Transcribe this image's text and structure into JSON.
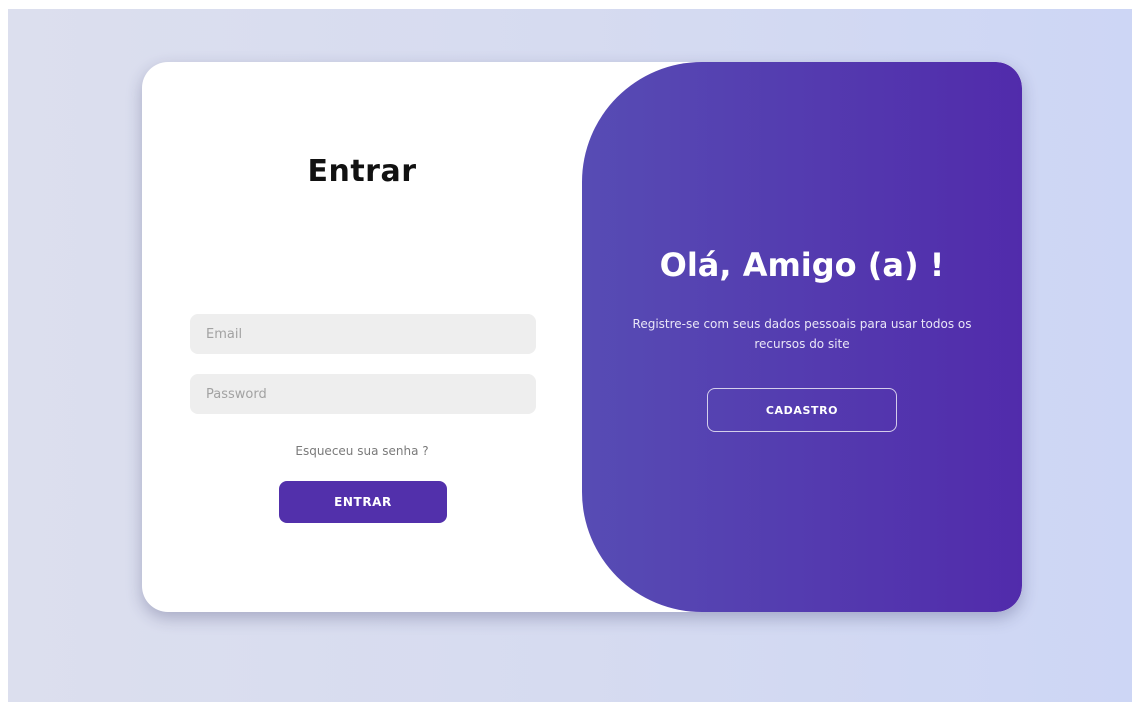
{
  "signin": {
    "title": "Entrar",
    "email_placeholder": "Email",
    "password_placeholder": "Password",
    "forgot_password": "Esqueceu sua senha ?",
    "button_label": "ENTRAR"
  },
  "toggle": {
    "title": "Olá, Amigo (a) !",
    "description": "Registre-se com seus dados pessoais para usar todos os recursos do site",
    "button_label": "CADASTRO"
  },
  "colors": {
    "accent": "#5230ab",
    "panel_gradient_start": "#574cb4",
    "panel_gradient_end": "#512bab",
    "input_background": "#eeeeee",
    "page_background": "#d6dbf0"
  }
}
